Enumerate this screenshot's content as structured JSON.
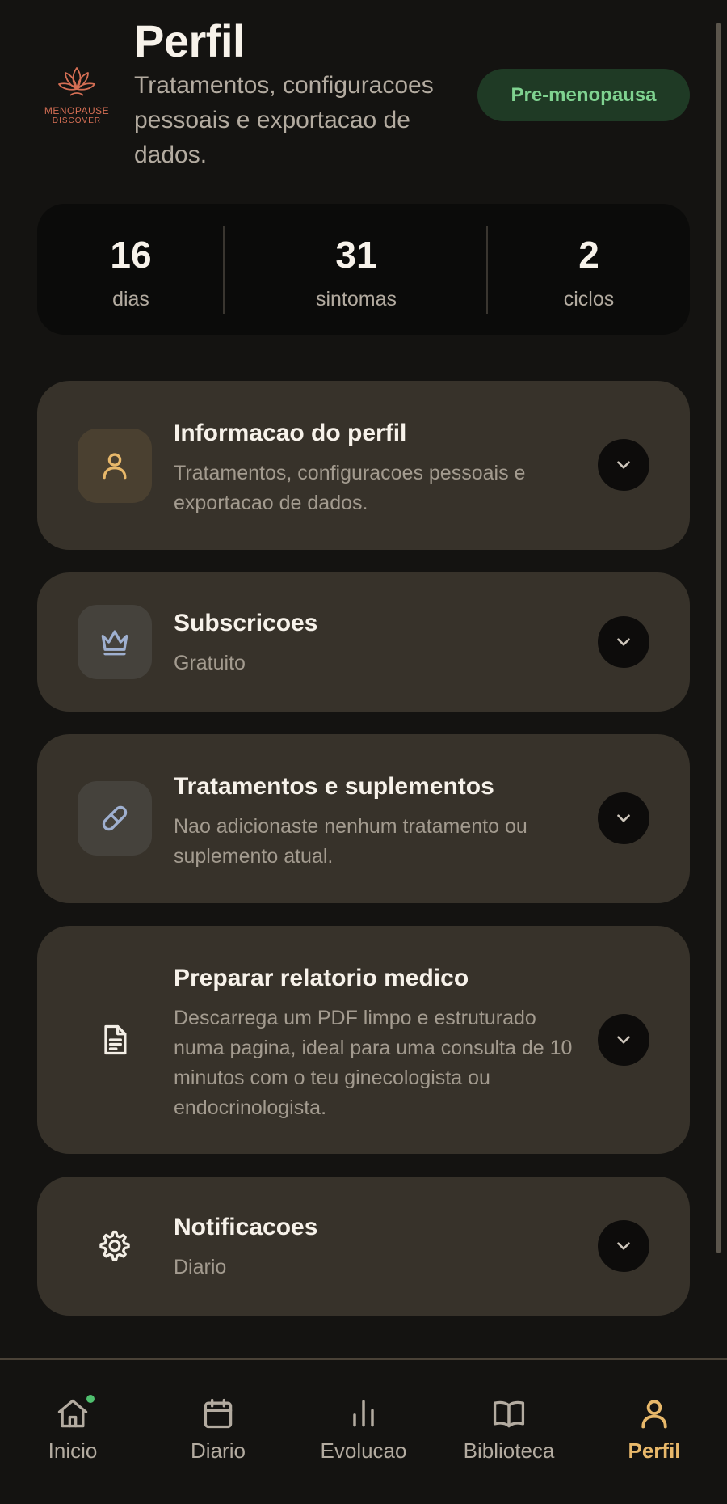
{
  "header": {
    "logo_line1": "MENOPAUSE",
    "logo_line2": "DISCOVER",
    "title": "Perfil",
    "subtitle": "Tratamentos, configuracoes pessoais e exportacao de dados.",
    "stage_badge": "Pre-menopausa"
  },
  "stats": [
    {
      "value": "16",
      "label": "dias"
    },
    {
      "value": "31",
      "label": "sintomas"
    },
    {
      "value": "2",
      "label": "ciclos"
    }
  ],
  "sections": [
    {
      "title": "Informacao do perfil",
      "description": "Tratamentos, configuracoes pessoais e exportacao de dados.",
      "icon": "user-icon"
    },
    {
      "title": "Subscricoes",
      "description": "Gratuito",
      "icon": "crown-icon"
    },
    {
      "title": "Tratamentos e suplementos",
      "description": "Nao adicionaste nenhum tratamento ou suplemento atual.",
      "icon": "pill-icon"
    },
    {
      "title": "Preparar relatorio medico",
      "description": "Descarrega um PDF limpo e estruturado numa pagina, ideal para uma consulta de 10 minutos com o teu ginecologista ou endocrinologista.",
      "icon": "document-icon"
    },
    {
      "title": "Notificacoes",
      "description": "Diario",
      "icon": "gear-icon"
    }
  ],
  "nav": [
    {
      "label": "Inicio",
      "icon": "home-icon"
    },
    {
      "label": "Diario",
      "icon": "calendar-icon"
    },
    {
      "label": "Evolucao",
      "icon": "bar-chart-icon"
    },
    {
      "label": "Biblioteca",
      "icon": "book-icon"
    },
    {
      "label": "Perfil",
      "icon": "user-icon",
      "active": true
    }
  ],
  "colors": {
    "background": "#141311",
    "card": "#37322a",
    "accent": "#e8b86a",
    "badge_bg": "#1f3a25",
    "badge_text": "#7fd290",
    "notification_dot": "#4fbf6e"
  }
}
